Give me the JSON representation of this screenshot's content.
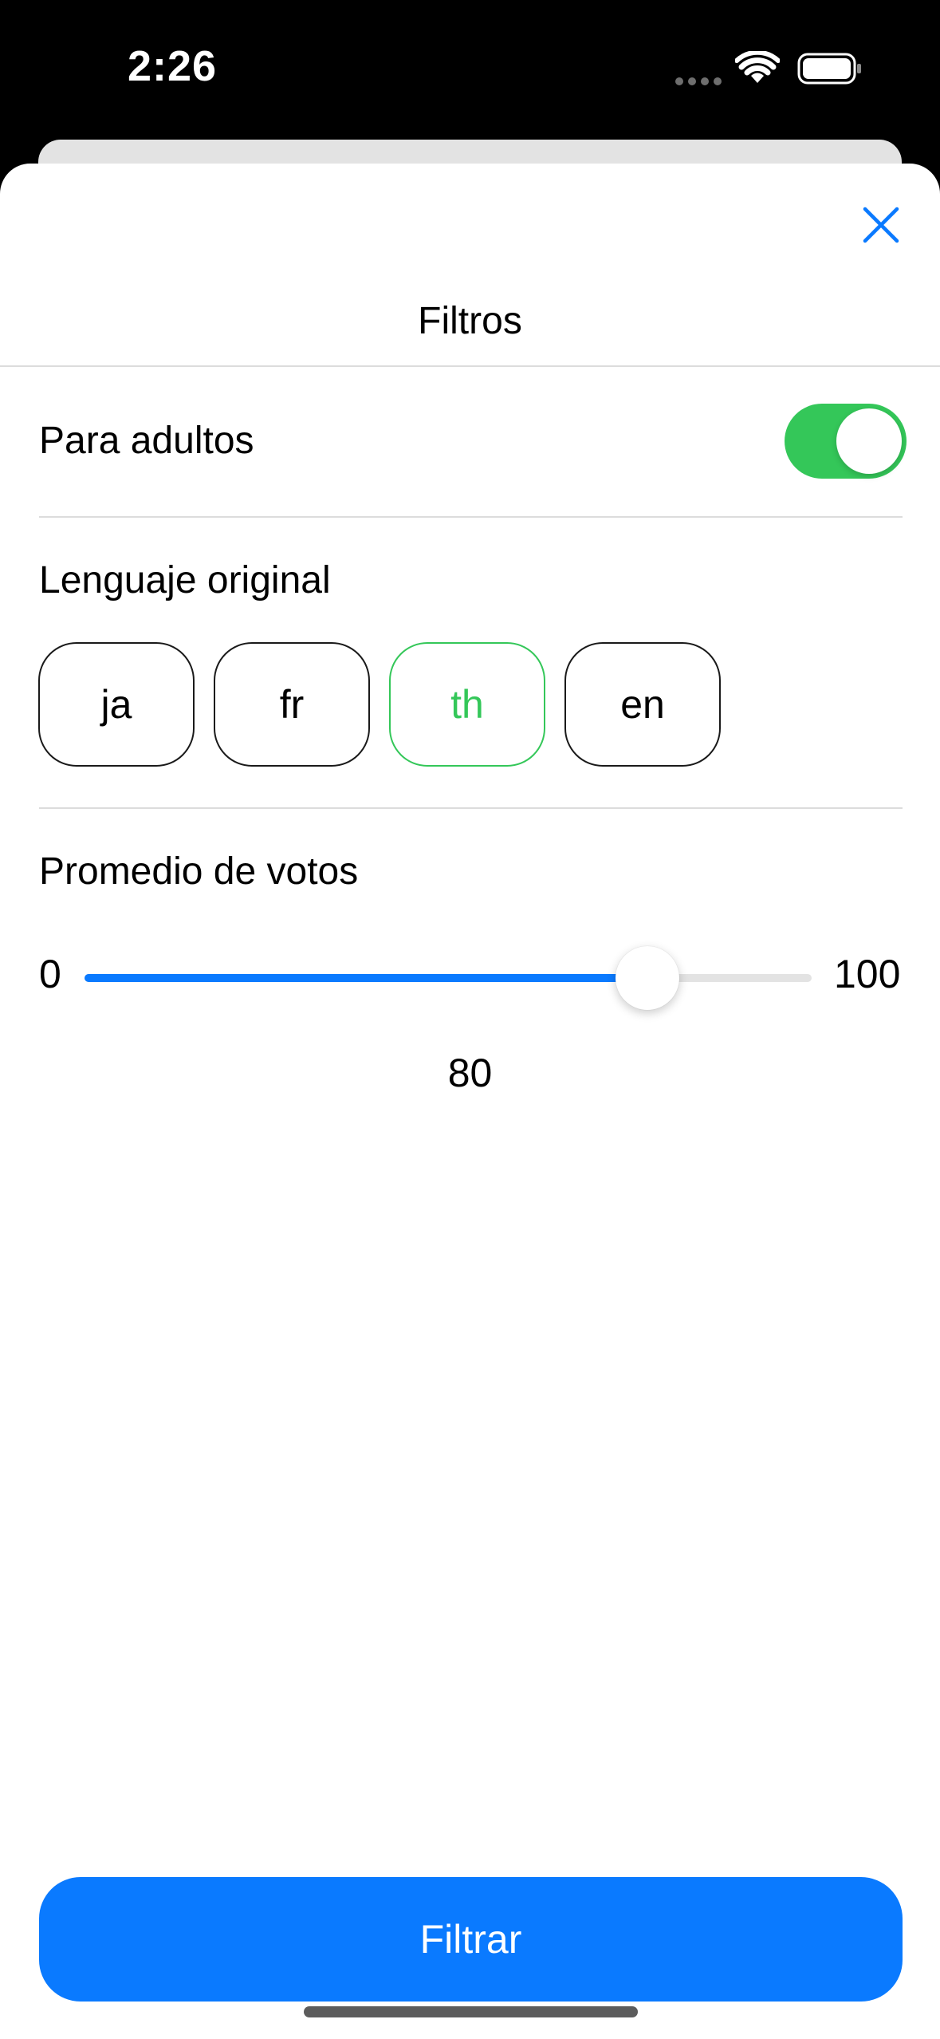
{
  "status_bar": {
    "time": "2:26",
    "icons": [
      "cellular-dots-icon",
      "wifi-icon",
      "battery-icon"
    ]
  },
  "sheet": {
    "title": "Filtros",
    "close_icon": "close-icon"
  },
  "adult_filter": {
    "label": "Para adultos",
    "enabled": true
  },
  "language_filter": {
    "label": "Lenguaje original",
    "options": [
      "ja",
      "fr",
      "th",
      "en"
    ],
    "selected": "th"
  },
  "vote_filter": {
    "label": "Promedio de votos",
    "min_label": "0",
    "max_label": "100",
    "min": 0,
    "max": 100,
    "value": 80,
    "value_label": "80"
  },
  "actions": {
    "filter_label": "Filtrar"
  },
  "colors": {
    "accent_blue": "#0a7aff",
    "toggle_green": "#34c759",
    "selected_chip": "#34c759"
  }
}
